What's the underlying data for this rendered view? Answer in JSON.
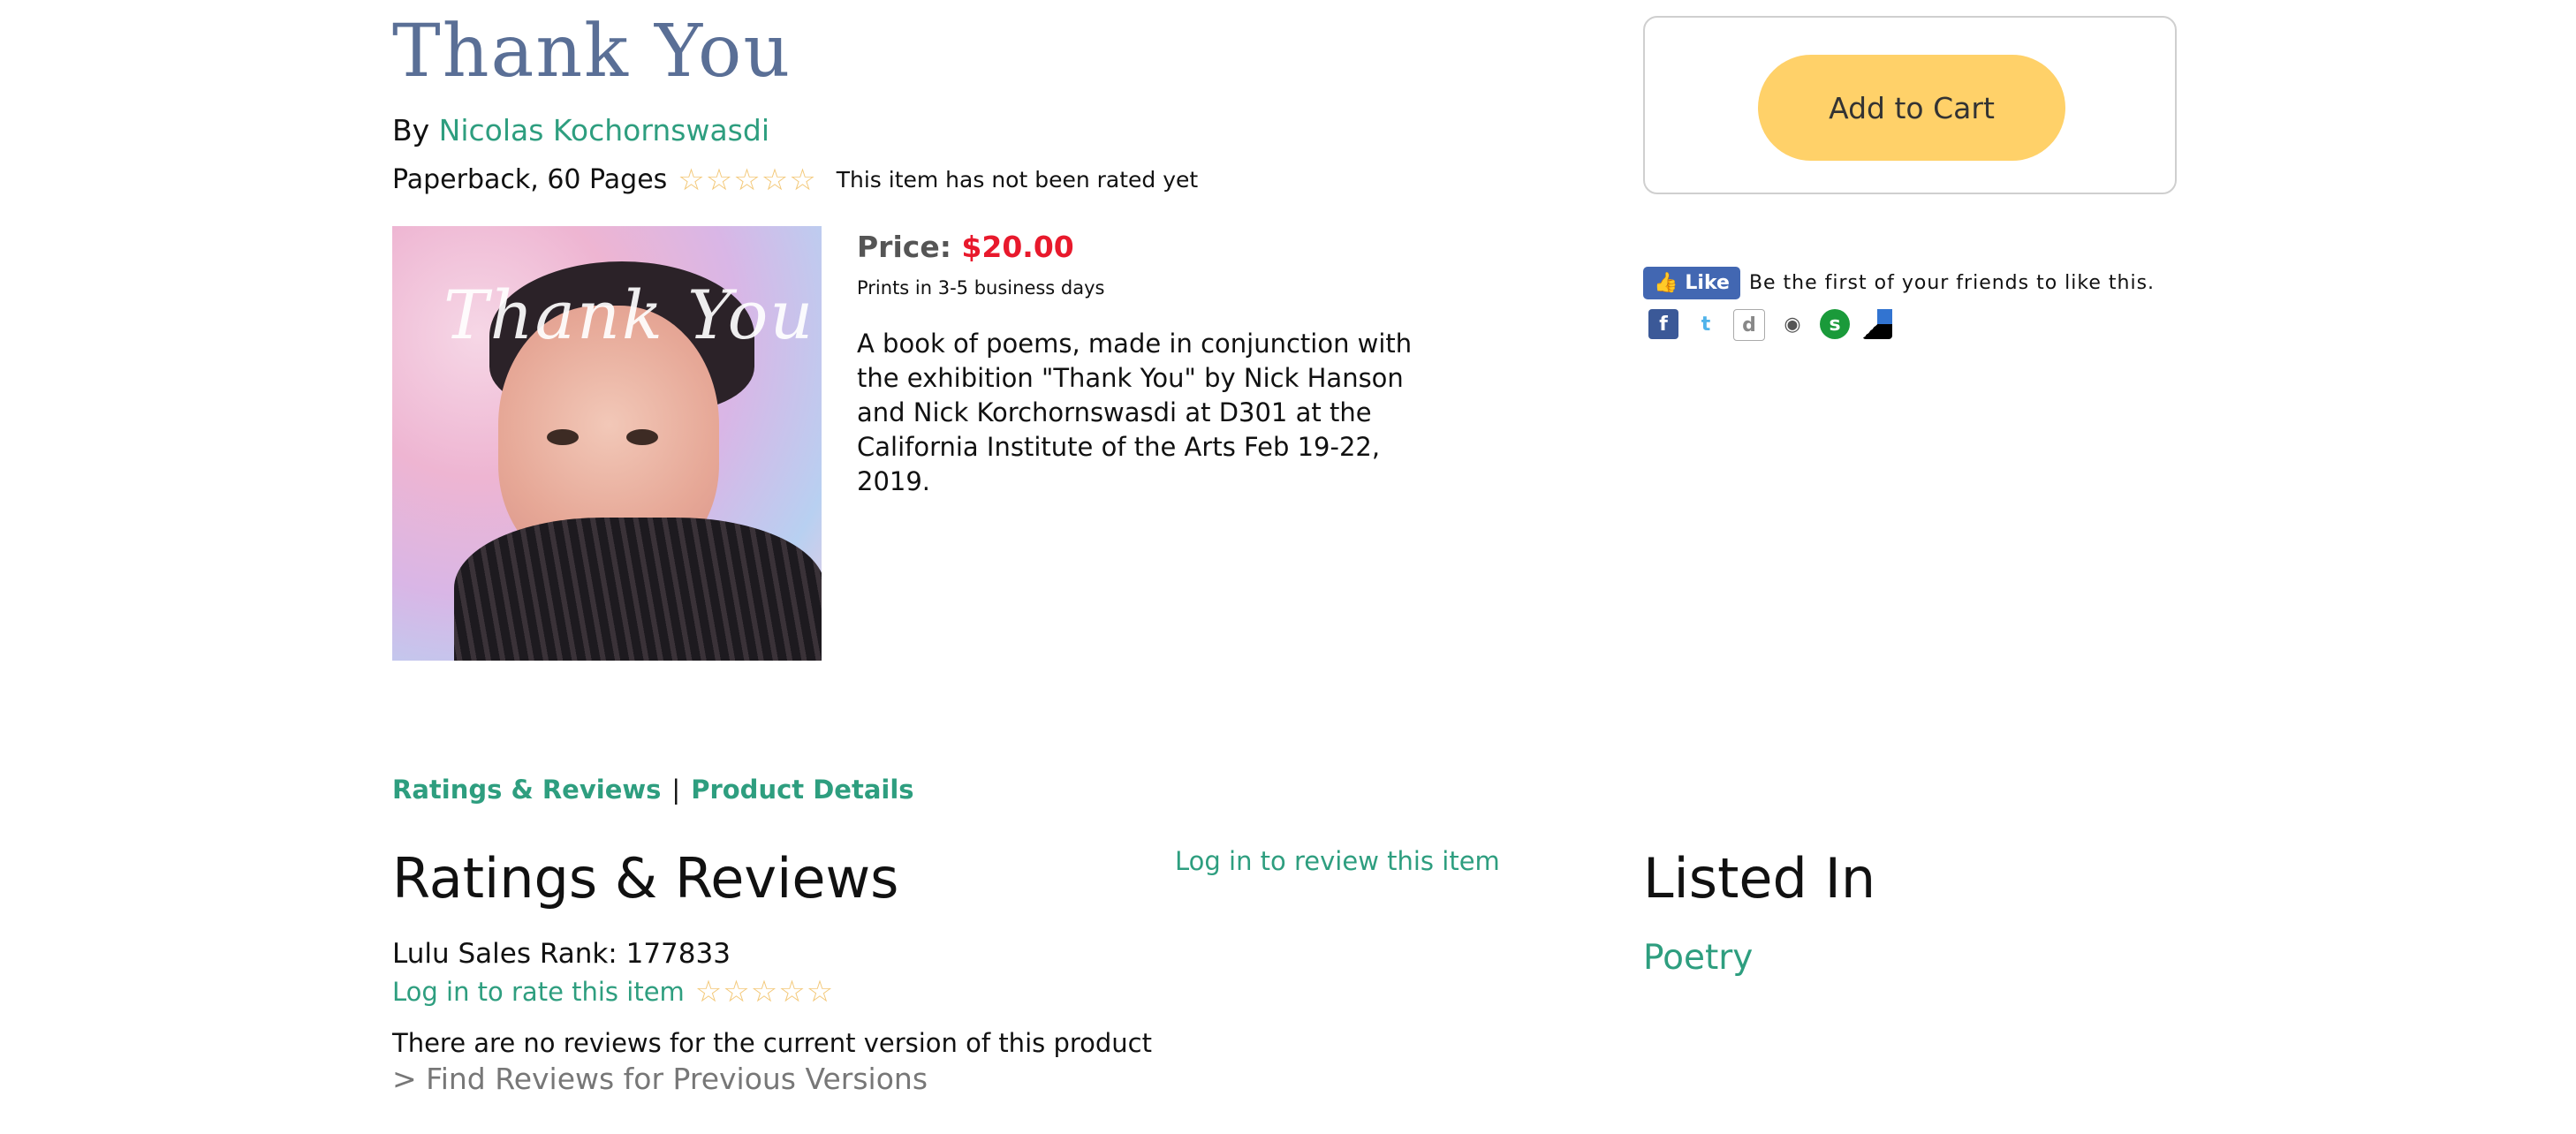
{
  "product": {
    "title": "Thank You",
    "by_label": "By",
    "author": "Nicolas Kochornswasdi",
    "format": "Paperback, 60 Pages",
    "rating_text": "This item has not been rated yet",
    "stars_filled": 0,
    "stars_total": 5,
    "cover_title": "Thank You",
    "price_label": "Price:",
    "price": "$20.00",
    "prints": "Prints in 3-5 business days",
    "description": "A book of poems, made in conjunction with the exhibition \"Thank You\" by Nick Hanson and Nick Korchornswasdi at D301 at the California Institute of the Arts Feb 19-22, 2019."
  },
  "cart": {
    "button_label": "Add to Cart"
  },
  "social": {
    "like_label": "Like",
    "like_text": "Be the first of your friends to like this.",
    "icons": [
      "facebook-icon",
      "twitter-icon",
      "digg-icon",
      "reddit-icon",
      "stumbleupon-icon",
      "delicious-icon"
    ]
  },
  "tabs": {
    "reviews": "Ratings & Reviews",
    "separator": "|",
    "details": "Product Details"
  },
  "reviews": {
    "heading": "Ratings & Reviews",
    "login_review": "Log in to review this item",
    "sales_rank": "Lulu Sales Rank: 177833",
    "login_rate": "Log in to rate this item",
    "no_reviews": "There are no reviews for the current version of this product",
    "previous": "> Find Reviews for Previous Versions"
  },
  "listed_in": {
    "heading": "Listed In",
    "items": [
      "Poetry"
    ]
  },
  "colors": {
    "accent": "#2e9e7f",
    "title": "#5a6f96",
    "price": "#e8192c",
    "cart": "#ffd169",
    "star": "#f3c878"
  }
}
